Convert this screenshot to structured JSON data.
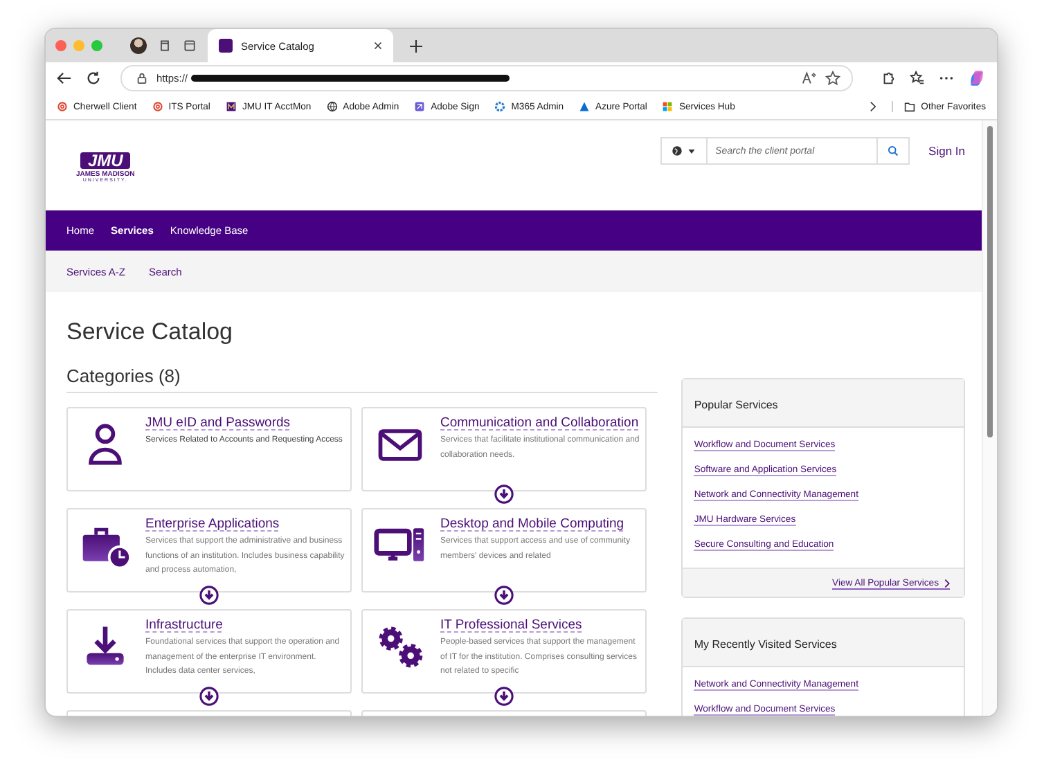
{
  "browser": {
    "tabs": [
      {
        "title": "Service Catalog",
        "selected": true
      }
    ],
    "address": "https://",
    "bookmarks": [
      {
        "label": "Cherwell Client"
      },
      {
        "label": "ITS Portal"
      },
      {
        "label": "JMU IT AcctMon"
      },
      {
        "label": "Adobe Admin"
      },
      {
        "label": "Adobe Sign"
      },
      {
        "label": "M365 Admin"
      },
      {
        "label": "Azure Portal"
      },
      {
        "label": "Services Hub"
      }
    ],
    "other_favorites": "Other Favorites"
  },
  "header": {
    "logo": "JMU",
    "logo_line1": "JAMES MADISON",
    "logo_line2": "UNIVERSITY.",
    "search_placeholder": "Search the client portal",
    "sign_in": "Sign In"
  },
  "nav": [
    {
      "label": "Home",
      "selected": false
    },
    {
      "label": "Services",
      "selected": true
    },
    {
      "label": "Knowledge Base",
      "selected": false
    }
  ],
  "subnav": [
    {
      "label": "Services A-Z"
    },
    {
      "label": "Search"
    }
  ],
  "title": "Service Catalog",
  "categories_heading": "Categories (8)",
  "categories": [
    {
      "title": "JMU eID and Passwords",
      "description": "Services Related to Accounts and Requesting Access",
      "expandable": false
    },
    {
      "title": "Communication and Collaboration",
      "description": "Services that facilitate institutional communication and collaboration needs.",
      "expandable": true
    },
    {
      "title": "Enterprise Applications",
      "description": "Services that support the administrative and business functions of an institution. Includes business capability and process automation,",
      "expandable": true
    },
    {
      "title": "Desktop and Mobile Computing",
      "description": "Services that support access and use of community members' devices and related",
      "expandable": true
    },
    {
      "title": "Infrastructure",
      "description": "Foundational services that support the operation and management of the enterprise IT environment. Includes data center services,",
      "expandable": true
    },
    {
      "title": "IT Professional Services",
      "description": "People-based services that support the management of IT for the institution. Comprises consulting services not related to specific",
      "expandable": true
    }
  ],
  "panels": [
    {
      "title": "Popular Services",
      "links": [
        "Workflow and Document Services",
        "Software and Application Services",
        "Network and Connectivity Management",
        "JMU Hardware Services",
        "Secure Consulting and Education"
      ],
      "footer_link": "View All Popular Services"
    },
    {
      "title": "My Recently Visited Services",
      "links": [
        "Network and Connectivity Management",
        "Workflow and Document Services"
      ]
    }
  ]
}
